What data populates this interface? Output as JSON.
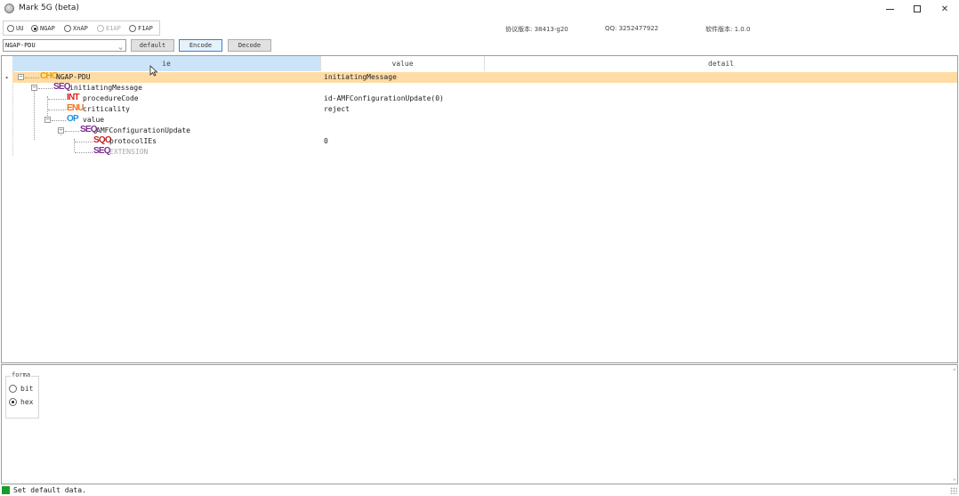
{
  "window": {
    "title": "Mark 5G (beta)",
    "minimize_icon": "minimize-icon",
    "maximize_icon": "maximize-icon",
    "close_glyph": "✕"
  },
  "protocols": [
    {
      "label": "UU",
      "selected": false,
      "disabled": false
    },
    {
      "label": "NGAP",
      "selected": true,
      "disabled": false
    },
    {
      "label": "XnAP",
      "selected": false,
      "disabled": false
    },
    {
      "label": "E1AP",
      "selected": false,
      "disabled": true
    },
    {
      "label": "F1AP",
      "selected": false,
      "disabled": false
    }
  ],
  "info": {
    "proto_version": "协议版本: 38413-g20",
    "qq": "QQ: 3252477922",
    "software_version": "软件版本: 1.0.0"
  },
  "toolbar": {
    "pdu_select_value": "NGAP-PDU",
    "default_label": "default",
    "encode_label": "Encode",
    "decode_label": "Decode"
  },
  "tree": {
    "columns": {
      "ie": "ie",
      "value": "value",
      "detail": "detail"
    },
    "rows": [
      {
        "tag": "CHO",
        "tag_color": "#f0a000",
        "name": "NGAP-PDU",
        "value": "initiatingMessage",
        "selected": true
      },
      {
        "tag": "SEQ",
        "tag_color": "#7a2a90",
        "name": "initiatingMessage",
        "value": "",
        "selected": false
      },
      {
        "tag": "INT",
        "tag_color": "#e02020",
        "name": "procedureCode",
        "value": "id-AMFConfigurationUpdate(0)",
        "selected": false
      },
      {
        "tag": "ENU",
        "tag_color": "#f07020",
        "name": "criticality",
        "value": "reject",
        "selected": false
      },
      {
        "tag": "OP",
        "tag_color": "#1e8fe0",
        "name": "value",
        "value": "",
        "selected": false
      },
      {
        "tag": "SEQ",
        "tag_color": "#7a2a90",
        "name": "AMFConfigurationUpdate",
        "value": "",
        "selected": false
      },
      {
        "tag": "SQO",
        "tag_color": "#c02020",
        "name": "protocolIEs",
        "value": "0",
        "selected": false
      },
      {
        "tag": "SEQ",
        "tag_color": "#7a2a90",
        "name": "EXTENSION",
        "value": "",
        "selected": false
      }
    ]
  },
  "format": {
    "legend": "forma",
    "options": [
      {
        "label": "bit",
        "selected": false
      },
      {
        "label": "hex",
        "selected": true
      }
    ]
  },
  "status": {
    "text": "Set default data.",
    "led_color": "#1a9c2a"
  }
}
